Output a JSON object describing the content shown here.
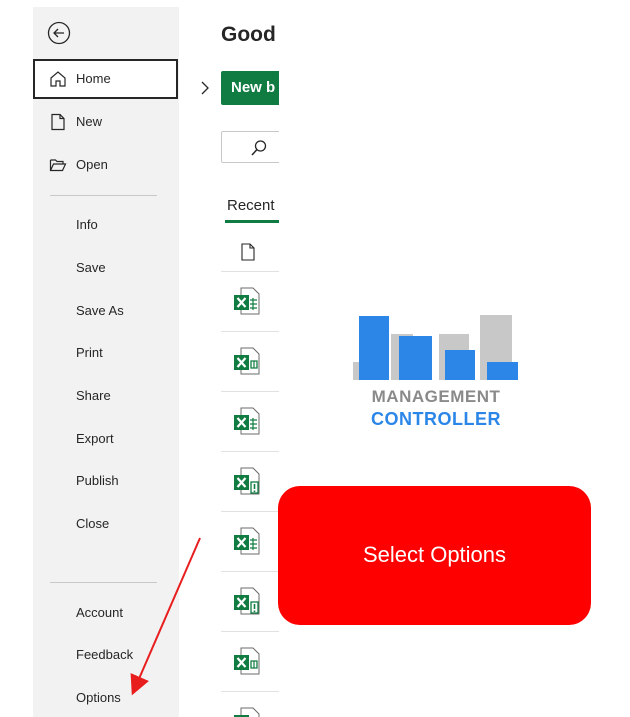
{
  "content": {
    "greeting": "Good",
    "new_button_label": "New b",
    "recent_tab_label": "Recent",
    "file_rows": [
      {
        "icon": "excel-file-icon"
      },
      {
        "icon": "excel-macro-file-icon"
      },
      {
        "icon": "excel-file-icon"
      },
      {
        "icon": "excel-alert-file-icon"
      },
      {
        "icon": "excel-file-icon"
      },
      {
        "icon": "excel-alert-file-icon"
      },
      {
        "icon": "excel-macro-file-icon"
      },
      {
        "icon": "excel-file-icon"
      }
    ]
  },
  "nav": {
    "top_items": [
      {
        "label": "Home",
        "icon": "home-icon",
        "selected": true
      },
      {
        "label": "New",
        "icon": "new-document-icon"
      },
      {
        "label": "Open",
        "icon": "folder-open-icon"
      }
    ],
    "middle_items": [
      "Info",
      "Save",
      "Save As",
      "Print",
      "Share",
      "Export",
      "Publish",
      "Close"
    ],
    "bottom_items": [
      "Account",
      "Feedback",
      "Options"
    ]
  },
  "logo": {
    "line1": "MANAGEMENT",
    "line2": "CONTROLLER",
    "colors": {
      "blue": "#2b86e8",
      "gray": "#c8c8c8",
      "text_gray": "#8a8a8a"
    }
  },
  "callout": {
    "text": "Select Options",
    "color": "#ff0000",
    "arrow_color": "#e81e1e"
  },
  "colors": {
    "excel_green": "#107c41",
    "nav_bg": "#f2f2f2"
  }
}
